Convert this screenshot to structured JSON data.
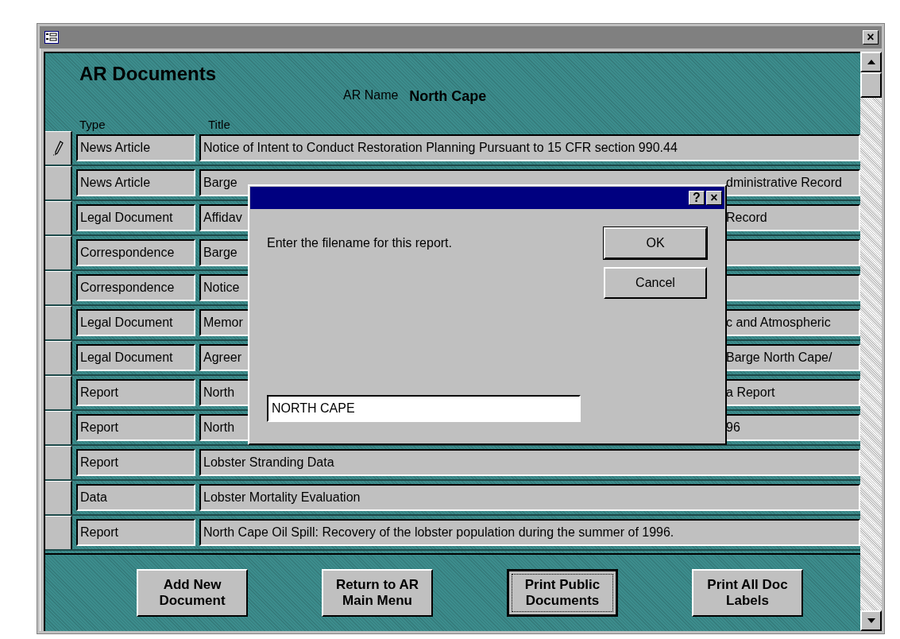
{
  "form": {
    "title": "AR Documents",
    "ar_name_label": "AR Name",
    "ar_name": "North Cape",
    "columns": [
      "Type",
      "Title"
    ]
  },
  "rows": [
    {
      "type": "News Article",
      "title": "Notice of Intent to Conduct Restoration Planning Pursuant to 15 CFR section 990.44",
      "editing": true
    },
    {
      "type": "News Article",
      "title": "Barge",
      "title_end": "dministrative Record",
      "editing": false
    },
    {
      "type": "Legal Document",
      "title": "Affidav",
      "title_end": "Record",
      "editing": false
    },
    {
      "type": "Correspondence",
      "title": "Barge",
      "editing": false
    },
    {
      "type": "Correspondence",
      "title": "Notice",
      "editing": false
    },
    {
      "type": "Legal Document",
      "title": "Memor",
      "title_end": "c and Atmospheric",
      "editing": false
    },
    {
      "type": "Legal Document",
      "title": "Agreer",
      "title_end": "Barge North Cape/",
      "editing": false
    },
    {
      "type": "Report",
      "title": "North",
      "title_end": "a Report",
      "editing": false
    },
    {
      "type": "Report",
      "title": "North",
      "title_end": "96",
      "editing": false
    },
    {
      "type": "Report",
      "title": "Lobster Stranding Data",
      "editing": false
    },
    {
      "type": "Data",
      "title": "Lobster Mortality Evaluation",
      "editing": false
    },
    {
      "type": "Report",
      "title": "North Cape Oil Spill: Recovery of the lobster population during the summer of 1996.",
      "editing": false
    }
  ],
  "buttons": [
    {
      "label": "Add New Document",
      "focused": false
    },
    {
      "label": "Return to AR Main Menu",
      "focused": false
    },
    {
      "label": "Print Public Documents",
      "focused": true
    },
    {
      "label": "Print All Doc Labels",
      "focused": false
    }
  ],
  "dialog": {
    "help": "?",
    "close": "×",
    "prompt": "Enter the filename for this report.",
    "ok": "OK",
    "cancel": "Cancel",
    "value": "NORTH CAPE"
  },
  "window": {
    "close": "×"
  }
}
